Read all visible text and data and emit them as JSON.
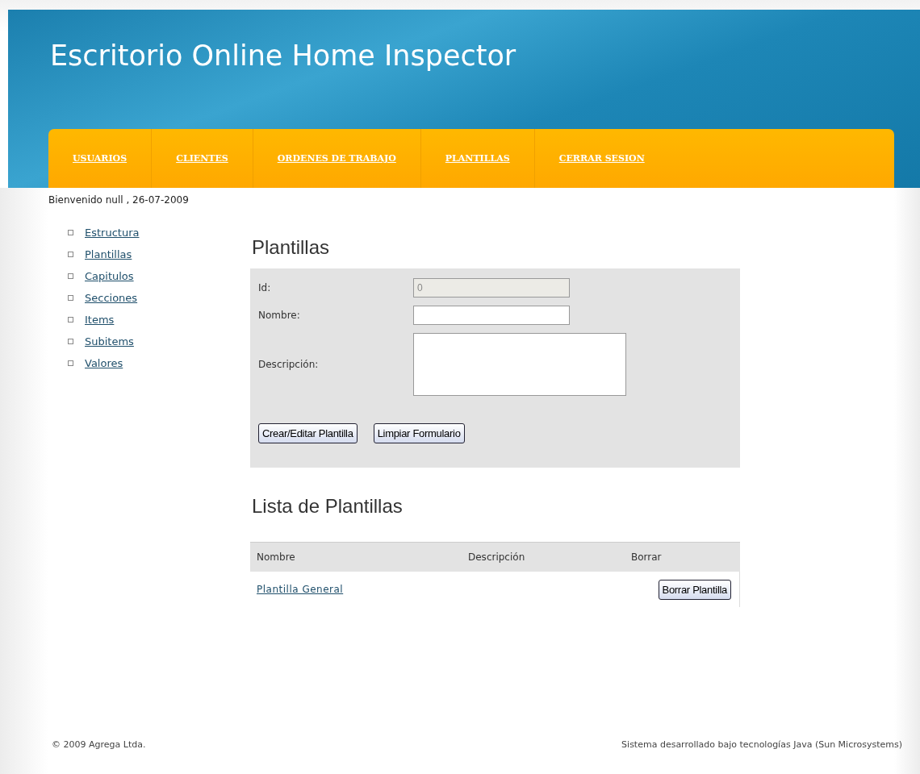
{
  "header": {
    "title": "Escritorio Online Home Inspector"
  },
  "nav": [
    {
      "label": "USUARIOS"
    },
    {
      "label": "CLIENTES"
    },
    {
      "label": "ORDENES DE TRABAJO"
    },
    {
      "label": "PLANTILLAS"
    },
    {
      "label": "CERRAR SESION"
    }
  ],
  "welcome": "Bienvenido null , 26-07-2009",
  "sidebar": {
    "items": [
      {
        "label": "Estructura"
      },
      {
        "label": "Plantillas"
      },
      {
        "label": "Capitulos"
      },
      {
        "label": "Secciones"
      },
      {
        "label": "Items"
      },
      {
        "label": "Subitems"
      },
      {
        "label": "Valores"
      }
    ]
  },
  "form": {
    "title": "Plantillas",
    "fields": [
      {
        "label": "Id:",
        "kind": "input",
        "value": "0",
        "disabled": true
      },
      {
        "label": "Nombre:",
        "kind": "input",
        "disabled": false
      },
      {
        "label": "Descripción:",
        "kind": "textarea",
        "disabled": false
      }
    ],
    "buttons": [
      "Crear/Editar Plantilla",
      "Limpiar Formulario"
    ]
  },
  "list": {
    "title": "Lista de Plantillas",
    "columns": [
      "Nombre",
      "Descripción",
      "Borrar"
    ],
    "rows": [
      {
        "name": "Plantilla General",
        "action": "Borrar Plantilla"
      }
    ]
  },
  "footer": {
    "left": "© 2009 Agrega Ltda.",
    "right": "Sistema desarrollado bajo tecnologías Java (Sun Microsystems)"
  }
}
